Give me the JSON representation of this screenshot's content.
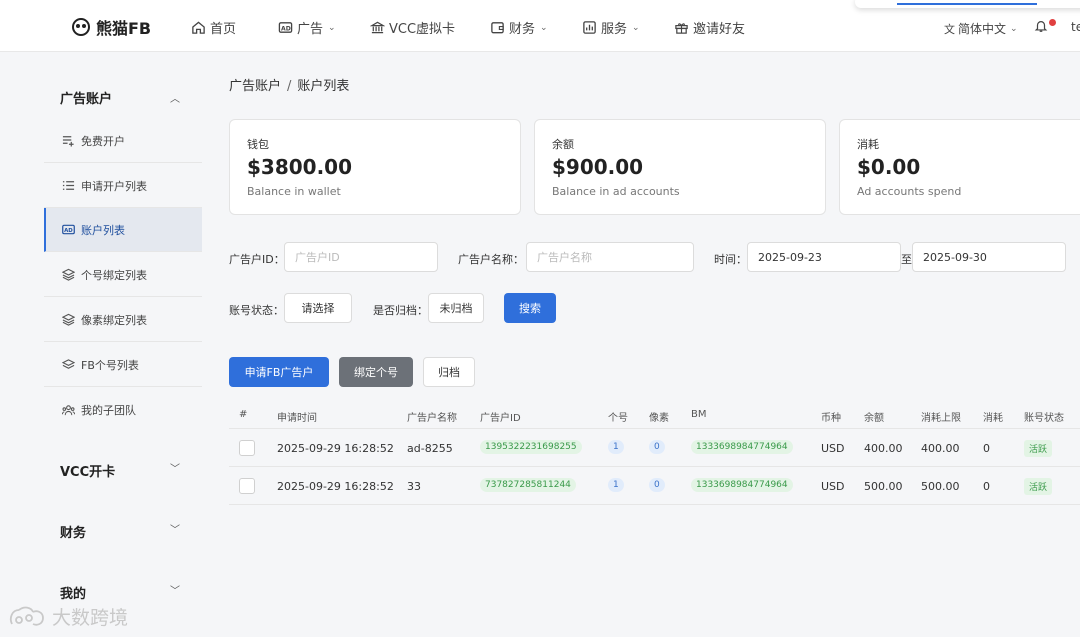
{
  "brand": {
    "name": "熊猫FB"
  },
  "nav": {
    "items": [
      {
        "label": "首页",
        "icon": "home-icon"
      },
      {
        "label": "广告",
        "icon": "ad-icon",
        "dropdown": true
      },
      {
        "label": "VCC虚拟卡",
        "icon": "bank-icon"
      },
      {
        "label": "财务",
        "icon": "wallet-icon",
        "dropdown": true
      },
      {
        "label": "服务",
        "icon": "chart-icon",
        "dropdown": true
      },
      {
        "label": "邀请好友",
        "icon": "gift-icon"
      }
    ],
    "language": "简体中文",
    "user": "te"
  },
  "sidebar": {
    "sections": [
      {
        "title": "广告账户",
        "expanded": true
      },
      {
        "title": "VCC开卡"
      },
      {
        "title": "财务"
      },
      {
        "title": "我的"
      }
    ],
    "items": [
      {
        "label": "免费开户",
        "icon": "list-add-icon"
      },
      {
        "label": "申请开户列表",
        "icon": "list-icon"
      },
      {
        "label": "账户列表",
        "icon": "ad-icon",
        "active": true
      },
      {
        "label": "个号绑定列表",
        "icon": "layers-icon"
      },
      {
        "label": "像素绑定列表",
        "icon": "layers-icon"
      },
      {
        "label": "FB个号列表",
        "icon": "layers-outline-icon"
      },
      {
        "label": "我的子团队",
        "icon": "team-icon"
      }
    ]
  },
  "breadcrumb": {
    "parent": "广告账户",
    "current": "账户列表"
  },
  "cards": [
    {
      "label": "钱包",
      "value": "$3800.00",
      "sub": "Balance in wallet"
    },
    {
      "label": "余额",
      "value": "$900.00",
      "sub": "Balance in ad accounts"
    },
    {
      "label": "消耗",
      "value": "$0.00",
      "sub": "Ad accounts spend"
    }
  ],
  "filters": {
    "ad_id_label": "广告户ID：",
    "ad_id_placeholder": "广告户ID",
    "ad_name_label": "广告户名称：",
    "ad_name_placeholder": "广告户名称",
    "time_label": "时间：",
    "date_from": "2025-09-23",
    "date_to_sep": "至",
    "date_to": "2025-09-30",
    "status_label": "账号状态：",
    "status_value": "请选择",
    "archived_label": "是否归档：",
    "archived_value": "未归档",
    "search_button": "搜索"
  },
  "actions": {
    "apply": "申请FB广告户",
    "bind": "绑定个号",
    "archive": "归档"
  },
  "table": {
    "columns": [
      "#",
      "申请时间",
      "广告户名称",
      "广告户ID",
      "个号",
      "像素",
      "BM",
      "币种",
      "余额",
      "消耗上限",
      "消耗",
      "账号状态"
    ],
    "rows": [
      {
        "time": "2025-09-29 16:28:52",
        "name": "ad-8255",
        "id": "1395322231698255",
        "personal": "1",
        "pixel": "0",
        "bm": "1333698984774964",
        "currency": "USD",
        "balance": "400.00",
        "limit": "400.00",
        "spend": "0",
        "status": "活跃"
      },
      {
        "time": "2025-09-29 16:28:52",
        "name": "33",
        "id": "737827285811244",
        "personal": "1",
        "pixel": "0",
        "bm": "1333698984774964",
        "currency": "USD",
        "balance": "500.00",
        "limit": "500.00",
        "spend": "0",
        "status": "活跃"
      }
    ]
  },
  "watermark": "大数跨境",
  "colors": {
    "primary": "#2f6fdb",
    "gray_button": "#6c7178",
    "tag_green": "#3a9a4a",
    "tag_blue": "#3b72c9",
    "notification": "#e04040"
  }
}
